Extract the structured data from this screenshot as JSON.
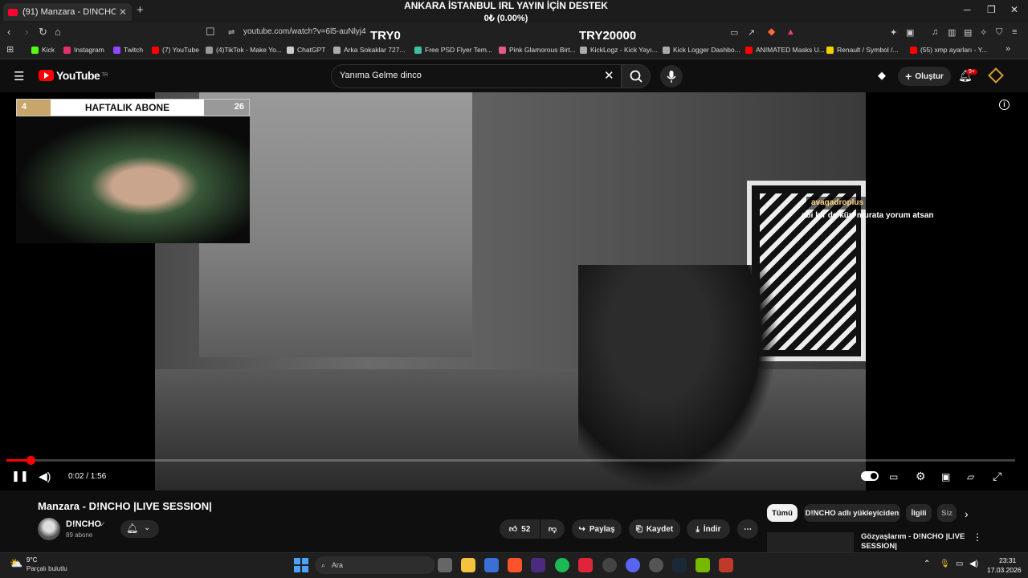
{
  "browser": {
    "tab_title": "(91) Manzara - D!NCHO |LIVE",
    "url": "youtube.com/watch?v=6l5-auNlyj4"
  },
  "stream_overlay": {
    "banner": "ANKARA İSTANBUL IRL YAYIN İÇİN DESTEK",
    "progress": "0₺ (0.00%)",
    "min_label": "TRY0",
    "max_label": "TRY20000",
    "progress_fraction": 0,
    "weekly_subs": {
      "title": "HAFTALIK ABONE",
      "current": "4",
      "goal": "26"
    },
    "chat": {
      "user": "avagadroplus",
      "message": "abi bir de kürt murata yorum atsan"
    }
  },
  "bookmarks": [
    {
      "label": "Kick",
      "icon": "kick-icon",
      "color": "#53fc18"
    },
    {
      "label": "Instagram",
      "icon": "instagram-icon",
      "color": "#e1306c"
    },
    {
      "label": "Twitch",
      "icon": "twitch-icon",
      "color": "#9146ff"
    },
    {
      "label": "(7) YouTube",
      "icon": "youtube-icon",
      "color": "#ff0000"
    },
    {
      "label": "(4)TikTok - Make Yo...",
      "icon": "tiktok-icon",
      "color": "#999999"
    },
    {
      "label": "ChatGPT",
      "icon": "chatgpt-icon",
      "color": "#cccccc"
    },
    {
      "label": "Arka Sokaklar 727...",
      "icon": "video-icon",
      "color": "#aaaaaa"
    },
    {
      "label": "Free PSD Flyer Tem...",
      "icon": "psd-icon",
      "color": "#3dbfa0"
    },
    {
      "label": "Pink Glamorous Birt...",
      "icon": "canva-icon",
      "color": "#e05a8a"
    },
    {
      "label": "KickLogz - Kick Yayı...",
      "icon": "globe-icon",
      "color": "#aaaaaa"
    },
    {
      "label": "Kick Logger Dashbo...",
      "icon": "globe-icon",
      "color": "#aaaaaa"
    },
    {
      "label": "ANIMATED Masks U...",
      "icon": "youtube-icon",
      "color": "#ff0000"
    },
    {
      "label": "Renault / Symbol /...",
      "icon": "sahibinden-icon",
      "color": "#f5d000"
    },
    {
      "label": "(55) xmp ayarları - Y...",
      "icon": "youtube-icon",
      "color": "#ff0000"
    }
  ],
  "youtube": {
    "logo": "YouTube",
    "region": "TR",
    "search_query": "Yanıma Gelme dinco",
    "create_label": "Oluştur",
    "notif_badge": "9+",
    "player": {
      "time": "0:02 / 1:56",
      "progress_fraction": 0.02
    },
    "video": {
      "title": "Manzara - D!NCHO |LIVE SESSION|",
      "channel": "D!NCHO",
      "subscribers": "89 abone",
      "likes": "52",
      "share": "Paylaş",
      "save": "Kaydet",
      "download": "İndir"
    },
    "chips": [
      "Tümü",
      "D!NCHO adlı yükleyiciden",
      "İlgili",
      "Siz"
    ],
    "related": {
      "title": "Gözyaşlarım - D!NCHO |LIVE SESSION|"
    }
  },
  "taskbar": {
    "temperature": "9°C",
    "condition": "Parçalı bulutlu",
    "search_placeholder": "Ara",
    "time": "23:31",
    "date": "17.03.2026"
  }
}
